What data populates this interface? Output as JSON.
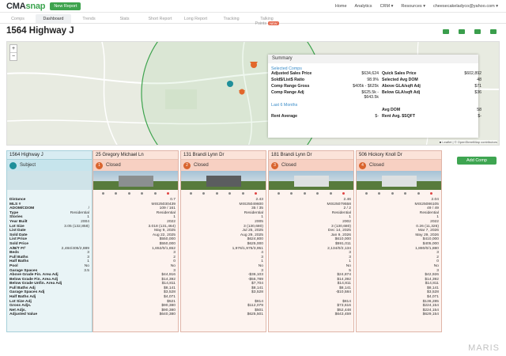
{
  "header": {
    "logo_a": "CMA",
    "logo_b": "snap",
    "new_report": "New Report",
    "nav": [
      "Home",
      "Analytics",
      "CRM ▾",
      "Resources ▾",
      "cheesecakeladyco@yahoo.com ▾"
    ]
  },
  "tabs": [
    {
      "label": "Comps"
    },
    {
      "label": "Dashboard"
    },
    {
      "label": "Trends"
    },
    {
      "label": "Stats"
    },
    {
      "label": "Short Report"
    },
    {
      "label": "Long Report"
    },
    {
      "label": "Tracking"
    },
    {
      "label": "Talking Points",
      "badge": "NEW"
    }
  ],
  "title": "1564 Highway J",
  "map": {
    "zoom_in": "+",
    "zoom_out": "−",
    "attribution": "■ Leaflet | © OpenStreetMap contributors"
  },
  "summary": {
    "title": "Summary",
    "selected_label": "Selected Comps",
    "selected_rows": [
      [
        "Adjusted Sales Price",
        "$634,624",
        "Quick Sales Price",
        "$602,892"
      ],
      [
        "Sold$/List$ Ratio",
        "98.9%",
        "Selected Avg DOM",
        "48"
      ],
      [
        "Comp Range Gross",
        "$405k - $625k",
        "Above GLA/sqft Adj",
        "$71"
      ],
      [
        "Comp Range Adj",
        "$625.5k - $643.5k",
        "Below GLA/sqft Adj",
        "$36"
      ]
    ],
    "last_label": "Last 6 Months",
    "last_rows": [
      [
        "",
        "",
        "Avg DOM",
        "58"
      ],
      [
        "Rent Average",
        "$-",
        "Rent Avg. $SQFT",
        "$-"
      ]
    ]
  },
  "add_comp": "Add Comp",
  "labels": [
    "Distance",
    "MLS #",
    "ADOM/CDOM",
    "Type",
    "Stories",
    "Year Built",
    "Lot Size",
    "List Date",
    "Sold Date",
    "List Price",
    "Sold Price",
    "A/B/T Ft²",
    "Beds",
    "Full Baths",
    "Half Baths",
    "Pool",
    "Garage Spaces",
    "Above Grade Fin. Area Adj",
    "Below Grade Fin. Area Adj",
    "Below Grade Unfin. Area Adj",
    "Full Baths Adj",
    "Garage Spaces Adj",
    "Half Baths Adj",
    "Lot Size Adj",
    "Gross Adjs.",
    "Net Adjs.",
    "Adjusted Value"
  ],
  "subject": {
    "address": "1564 Highway J",
    "status": "Subject",
    "values": [
      "",
      "",
      "/",
      "Residential",
      "1",
      "2004",
      "3.05 (132,858)",
      "",
      "",
      "",
      "",
      "2,484/405/2,889",
      "3",
      "3",
      "1",
      "No",
      "3.5",
      "",
      "",
      "",
      "",
      "",
      "",
      "",
      "",
      "",
      ""
    ]
  },
  "comps": [
    {
      "num": "1",
      "address": "25 Gregory Michael Ln",
      "status": "Closed",
      "house": "",
      "values": [
        "0.7",
        "MIS25030439",
        "109 / 161",
        "Residential",
        "1",
        "2022",
        "3.018 (131,464)",
        "May 9, 2025",
        "Aug 22, 2025",
        "$550,000",
        "$550,000",
        "1,652/0/1,652",
        "3",
        "2",
        "0",
        "No",
        "3",
        "$44,916",
        "$14,392",
        "$14,811",
        "$8,141",
        "$3,528",
        "$4,071",
        "$521",
        "$90,380",
        "$90,380",
        "$640,380"
      ]
    },
    {
      "num": "2",
      "address": "131 Brandi Lynn Dr",
      "status": "Closed",
      "house": "dark",
      "values": [
        "2.43",
        "MIS25049600",
        "35 / 35",
        "Residential",
        "1",
        "2005",
        "3 (130,680)",
        "Jul 25, 2025",
        "Aug 29, 2025",
        "$624,800",
        "$625,000",
        "1,976/1,975/3,951",
        "4",
        "3",
        "1",
        "No",
        "3",
        "-$36,103",
        "-$55,789",
        "$7,704",
        "$8,141",
        "$3,528",
        "",
        "$814",
        "$112,079",
        "$501",
        "$625,501"
      ]
    },
    {
      "num": "3",
      "address": "181 Brandi Lynn Dr",
      "status": "Closed",
      "house": "white",
      "values": [
        "2.46",
        "MIS25079558",
        "2 / 2",
        "Residential",
        "1",
        "2002",
        "3 (130,680)",
        "Dec 14, 2025",
        "Jan 9, 2026",
        "$610,000",
        "$591,011",
        "2,134/0/2,134",
        "3",
        "3",
        "1",
        "No",
        "5",
        "$24,874",
        "$14,392",
        "$14,811",
        "$8,141",
        "-$10,584",
        "",
        "$814",
        "$73,616",
        "$52,448",
        "$643,459"
      ]
    },
    {
      "num": "4",
      "address": "506 Hickory Knoll Dr",
      "status": "Closed",
      "house": "white",
      "values": [
        "2.04",
        "MIS25086105",
        "49 / 49",
        "Residential",
        "1",
        "2022",
        "0.26 (11,326)",
        "Mar 7, 2026",
        "May 29, 2026",
        "$410,000",
        "$405,000",
        "1,880/0/1,880",
        "3",
        "2",
        "0",
        "No",
        "3",
        "$42,926",
        "$14,392",
        "$14,811",
        "$8,141",
        "$3,528",
        "$4,071",
        "$136,285",
        "$224,154",
        "$224,154",
        "$629,154"
      ]
    }
  ],
  "watermark": "MARIS"
}
